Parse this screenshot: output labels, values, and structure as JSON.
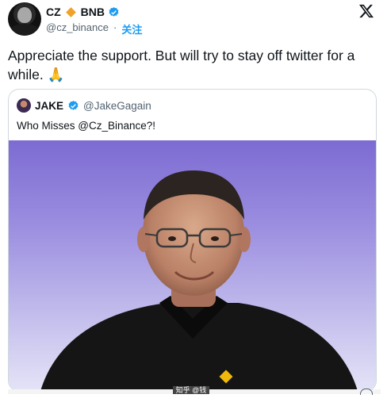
{
  "author": {
    "name": "CZ",
    "badge_text": "BNB",
    "handle": "@cz_binance",
    "follow_label": "关注"
  },
  "tweet": {
    "text": "Appreciate the support. But will try to stay off twitter for a while. 🙏"
  },
  "quoted": {
    "name": "JAKE",
    "handle": "@JakeGagain",
    "text": "Who Misses @Cz_Binance?!"
  },
  "colors": {
    "accent": "#1d9bf0",
    "bnb": "#f0a12a",
    "muted": "#536471"
  },
  "icons": {
    "brand": "x-logo-icon",
    "verified": "verified-badge-icon",
    "share": "share-icon"
  },
  "watermark": {
    "text": "知乎 @钱子"
  }
}
